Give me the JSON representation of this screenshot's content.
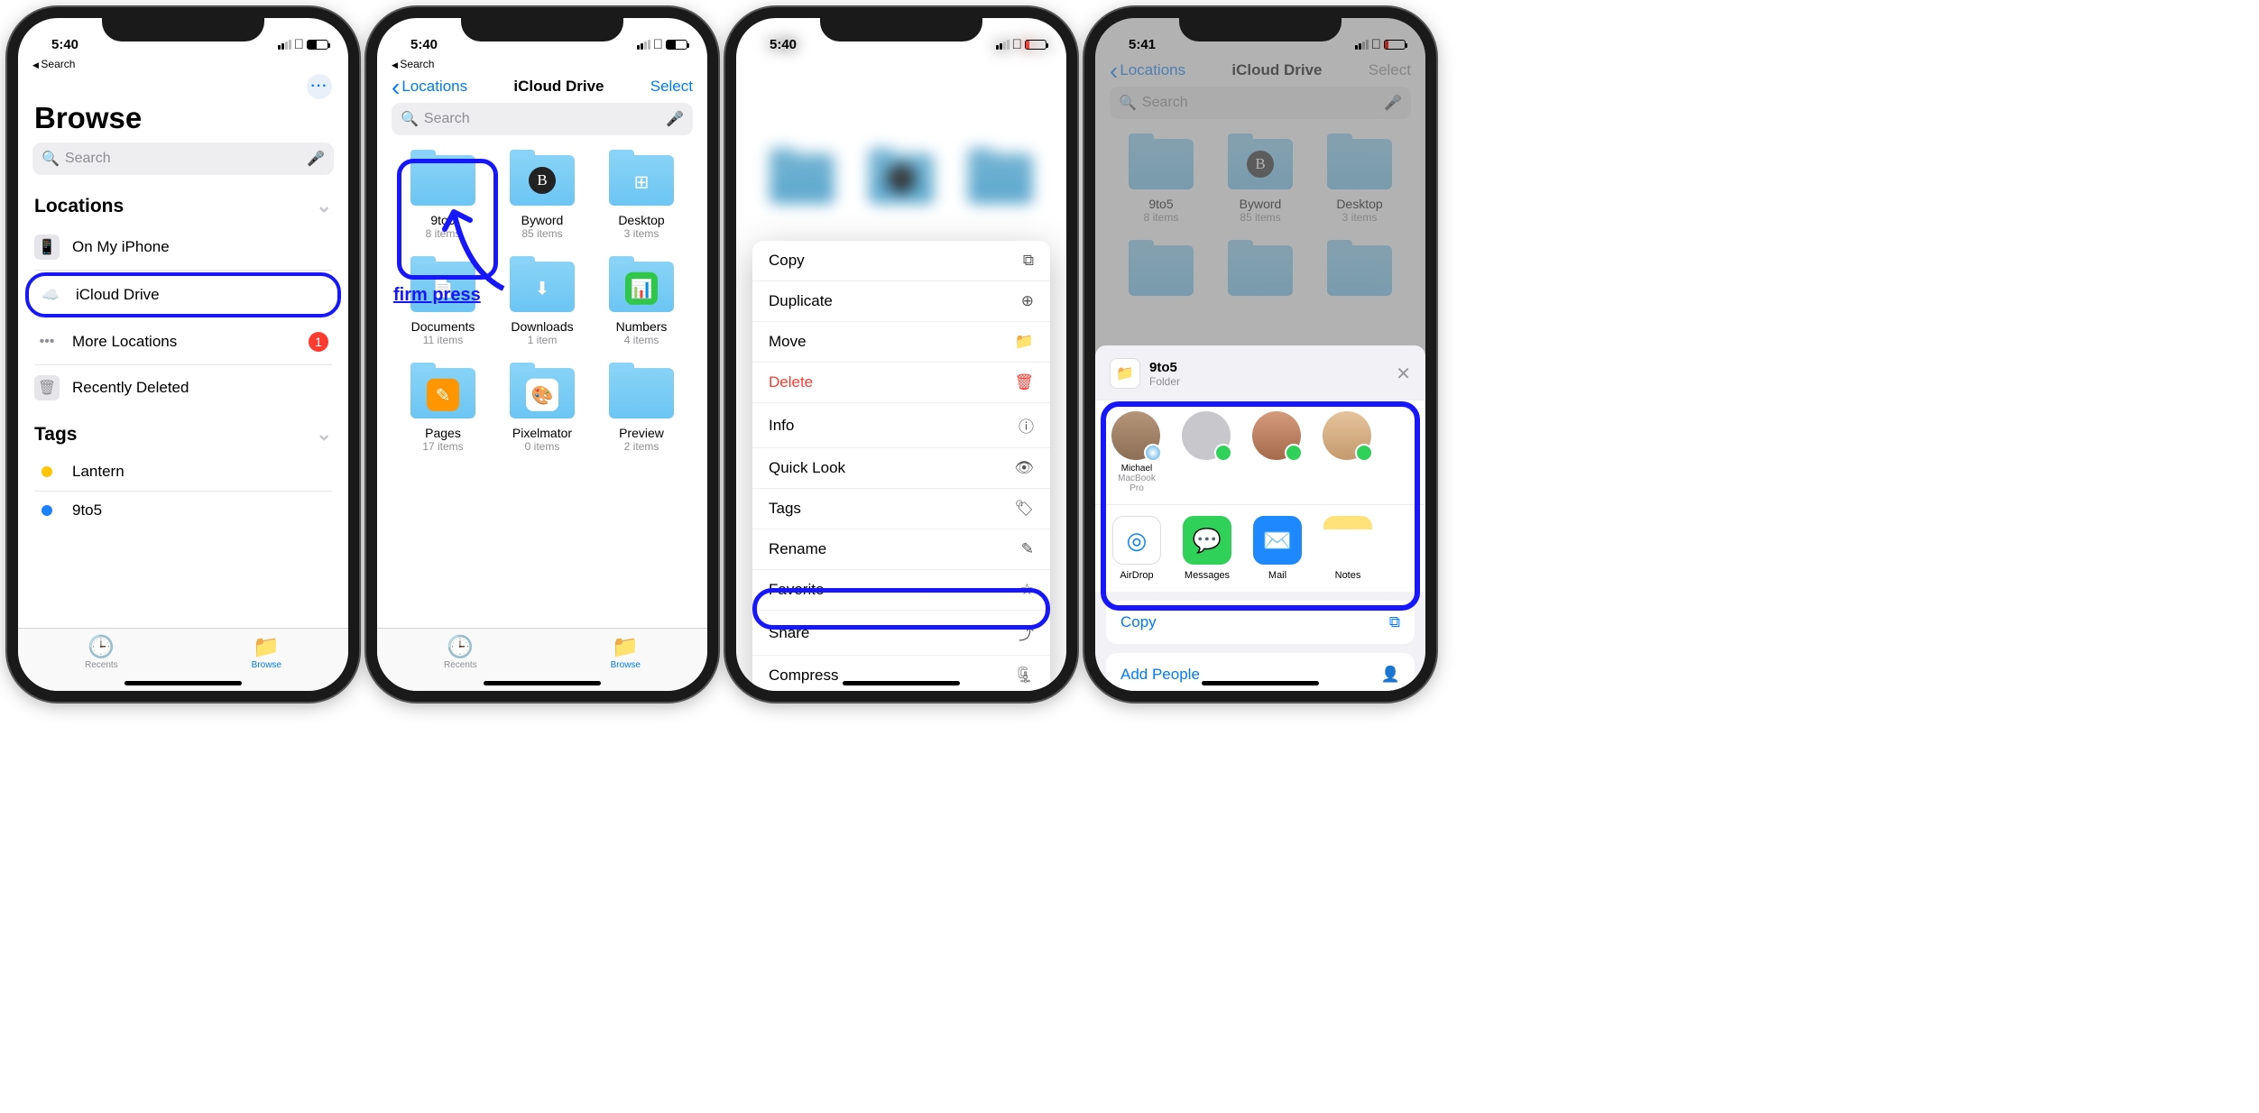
{
  "status": {
    "time_1": "5:40",
    "time_2": "5:40",
    "time_3": "5:40",
    "time_4": "5:41"
  },
  "common": {
    "back_small": "Search",
    "search_placeholder": "Search"
  },
  "s1": {
    "title": "Browse",
    "sec_locations": "Locations",
    "row_phone": "On My iPhone",
    "row_icloud": "iCloud Drive",
    "row_more": "More Locations",
    "row_more_badge": "1",
    "row_trash": "Recently Deleted",
    "sec_tags": "Tags",
    "tag1": "Lantern",
    "tag2": "9to5",
    "tab_recents": "Recents",
    "tab_browse": "Browse"
  },
  "s2": {
    "nav_back": "Locations",
    "title": "iCloud Drive",
    "select": "Select",
    "firm_press": "firm press",
    "folders": {
      "f1": {
        "name": "9to5",
        "count": "8 items"
      },
      "f2": {
        "name": "Byword",
        "count": "85 items"
      },
      "f3": {
        "name": "Desktop",
        "count": "3 items"
      },
      "f4": {
        "name": "Documents",
        "count": "11 items"
      },
      "f5": {
        "name": "Downloads",
        "count": "1 item"
      },
      "f6": {
        "name": "Numbers",
        "count": "4 items"
      },
      "f7": {
        "name": "Pages",
        "count": "17 items"
      },
      "f8": {
        "name": "Pixelmator",
        "count": "0 items"
      },
      "f9": {
        "name": "Preview",
        "count": "2 items"
      }
    }
  },
  "s3": {
    "menu": {
      "copy": "Copy",
      "duplicate": "Duplicate",
      "move": "Move",
      "delete": "Delete",
      "info": "Info",
      "quicklook": "Quick Look",
      "tags": "Tags",
      "rename": "Rename",
      "favorite": "Favorite",
      "share": "Share",
      "compress": "Compress"
    }
  },
  "s4": {
    "nav_back": "Locations",
    "title": "iCloud Drive",
    "select": "Select",
    "share_name": "9to5",
    "share_sub": "Folder",
    "contact1": {
      "name": "Michael",
      "sub": "MacBook Pro"
    },
    "apps": {
      "airdrop": "AirDrop",
      "messages": "Messages",
      "mail": "Mail",
      "notes": "Notes"
    },
    "action_copy": "Copy",
    "action_add": "Add People"
  }
}
